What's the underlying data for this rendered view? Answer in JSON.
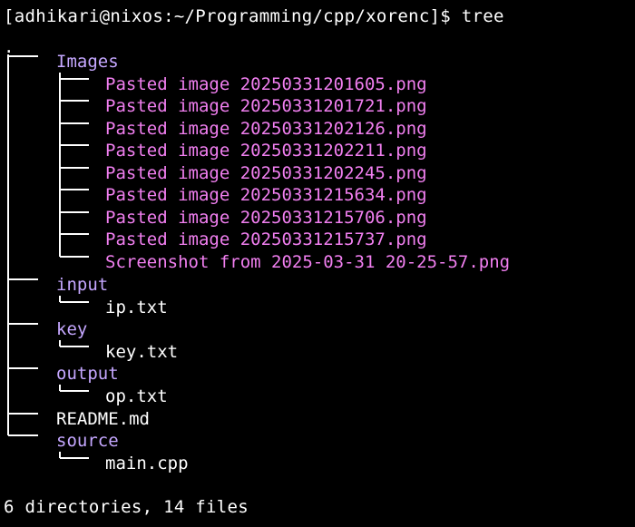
{
  "terminal": {
    "prompt": "[adhikari@nixos:~/Programming/cpp/xorenc]$ tree",
    "root": ".",
    "summary": "6 directories, 14 files"
  },
  "tree": {
    "images_dir": "Images",
    "images": [
      "Pasted image 20250331201605.png",
      "Pasted image 20250331201721.png",
      "Pasted image 20250331202126.png",
      "Pasted image 20250331202211.png",
      "Pasted image 20250331202245.png",
      "Pasted image 20250331215634.png",
      "Pasted image 20250331215706.png",
      "Pasted image 20250331215737.png"
    ],
    "screenshot": "Screenshot from 2025-03-31 20-25-57.png",
    "input_dir": "input",
    "input_file": "ip.txt",
    "key_dir": "key",
    "key_file": "key.txt",
    "output_dir": "output",
    "output_file": "op.txt",
    "readme": "README.md",
    "source_dir": "source",
    "source_file": "main.cpp"
  },
  "colors": {
    "background": "#000000",
    "text": "#ffffff",
    "directory": "#c5a7ff",
    "image": "#f17ff0"
  }
}
